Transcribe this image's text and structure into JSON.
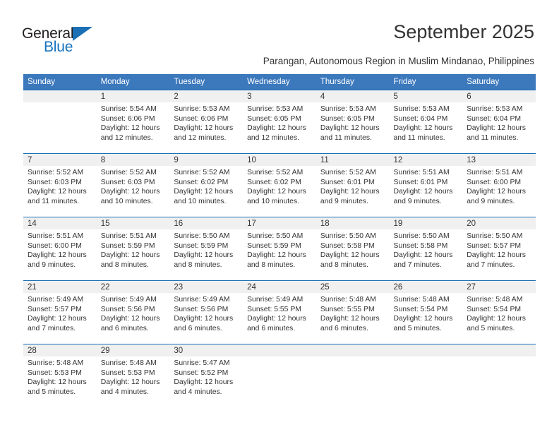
{
  "brand": {
    "name_top": "General",
    "name_bottom": "Blue"
  },
  "header": {
    "title": "September 2025",
    "subtitle": "Parangan, Autonomous Region in Muslim Mindanao, Philippines"
  },
  "colors": {
    "header_blue": "#3b78bc",
    "rule_blue": "#1a6fb5",
    "daynum_band": "#f0f0f0",
    "logo_blue": "#1673c0",
    "text": "#333333"
  },
  "calendar": {
    "weekday_headers": [
      "Sunday",
      "Monday",
      "Tuesday",
      "Wednesday",
      "Thursday",
      "Friday",
      "Saturday"
    ],
    "weeks": [
      [
        {
          "day": "",
          "sunrise": "",
          "sunset": "",
          "daylight": ""
        },
        {
          "day": "1",
          "sunrise": "Sunrise: 5:54 AM",
          "sunset": "Sunset: 6:06 PM",
          "daylight": "Daylight: 12 hours and 12 minutes."
        },
        {
          "day": "2",
          "sunrise": "Sunrise: 5:53 AM",
          "sunset": "Sunset: 6:06 PM",
          "daylight": "Daylight: 12 hours and 12 minutes."
        },
        {
          "day": "3",
          "sunrise": "Sunrise: 5:53 AM",
          "sunset": "Sunset: 6:05 PM",
          "daylight": "Daylight: 12 hours and 12 minutes."
        },
        {
          "day": "4",
          "sunrise": "Sunrise: 5:53 AM",
          "sunset": "Sunset: 6:05 PM",
          "daylight": "Daylight: 12 hours and 11 minutes."
        },
        {
          "day": "5",
          "sunrise": "Sunrise: 5:53 AM",
          "sunset": "Sunset: 6:04 PM",
          "daylight": "Daylight: 12 hours and 11 minutes."
        },
        {
          "day": "6",
          "sunrise": "Sunrise: 5:53 AM",
          "sunset": "Sunset: 6:04 PM",
          "daylight": "Daylight: 12 hours and 11 minutes."
        }
      ],
      [
        {
          "day": "7",
          "sunrise": "Sunrise: 5:52 AM",
          "sunset": "Sunset: 6:03 PM",
          "daylight": "Daylight: 12 hours and 11 minutes."
        },
        {
          "day": "8",
          "sunrise": "Sunrise: 5:52 AM",
          "sunset": "Sunset: 6:03 PM",
          "daylight": "Daylight: 12 hours and 10 minutes."
        },
        {
          "day": "9",
          "sunrise": "Sunrise: 5:52 AM",
          "sunset": "Sunset: 6:02 PM",
          "daylight": "Daylight: 12 hours and 10 minutes."
        },
        {
          "day": "10",
          "sunrise": "Sunrise: 5:52 AM",
          "sunset": "Sunset: 6:02 PM",
          "daylight": "Daylight: 12 hours and 10 minutes."
        },
        {
          "day": "11",
          "sunrise": "Sunrise: 5:52 AM",
          "sunset": "Sunset: 6:01 PM",
          "daylight": "Daylight: 12 hours and 9 minutes."
        },
        {
          "day": "12",
          "sunrise": "Sunrise: 5:51 AM",
          "sunset": "Sunset: 6:01 PM",
          "daylight": "Daylight: 12 hours and 9 minutes."
        },
        {
          "day": "13",
          "sunrise": "Sunrise: 5:51 AM",
          "sunset": "Sunset: 6:00 PM",
          "daylight": "Daylight: 12 hours and 9 minutes."
        }
      ],
      [
        {
          "day": "14",
          "sunrise": "Sunrise: 5:51 AM",
          "sunset": "Sunset: 6:00 PM",
          "daylight": "Daylight: 12 hours and 9 minutes."
        },
        {
          "day": "15",
          "sunrise": "Sunrise: 5:51 AM",
          "sunset": "Sunset: 5:59 PM",
          "daylight": "Daylight: 12 hours and 8 minutes."
        },
        {
          "day": "16",
          "sunrise": "Sunrise: 5:50 AM",
          "sunset": "Sunset: 5:59 PM",
          "daylight": "Daylight: 12 hours and 8 minutes."
        },
        {
          "day": "17",
          "sunrise": "Sunrise: 5:50 AM",
          "sunset": "Sunset: 5:59 PM",
          "daylight": "Daylight: 12 hours and 8 minutes."
        },
        {
          "day": "18",
          "sunrise": "Sunrise: 5:50 AM",
          "sunset": "Sunset: 5:58 PM",
          "daylight": "Daylight: 12 hours and 8 minutes."
        },
        {
          "day": "19",
          "sunrise": "Sunrise: 5:50 AM",
          "sunset": "Sunset: 5:58 PM",
          "daylight": "Daylight: 12 hours and 7 minutes."
        },
        {
          "day": "20",
          "sunrise": "Sunrise: 5:50 AM",
          "sunset": "Sunset: 5:57 PM",
          "daylight": "Daylight: 12 hours and 7 minutes."
        }
      ],
      [
        {
          "day": "21",
          "sunrise": "Sunrise: 5:49 AM",
          "sunset": "Sunset: 5:57 PM",
          "daylight": "Daylight: 12 hours and 7 minutes."
        },
        {
          "day": "22",
          "sunrise": "Sunrise: 5:49 AM",
          "sunset": "Sunset: 5:56 PM",
          "daylight": "Daylight: 12 hours and 6 minutes."
        },
        {
          "day": "23",
          "sunrise": "Sunrise: 5:49 AM",
          "sunset": "Sunset: 5:56 PM",
          "daylight": "Daylight: 12 hours and 6 minutes."
        },
        {
          "day": "24",
          "sunrise": "Sunrise: 5:49 AM",
          "sunset": "Sunset: 5:55 PM",
          "daylight": "Daylight: 12 hours and 6 minutes."
        },
        {
          "day": "25",
          "sunrise": "Sunrise: 5:48 AM",
          "sunset": "Sunset: 5:55 PM",
          "daylight": "Daylight: 12 hours and 6 minutes."
        },
        {
          "day": "26",
          "sunrise": "Sunrise: 5:48 AM",
          "sunset": "Sunset: 5:54 PM",
          "daylight": "Daylight: 12 hours and 5 minutes."
        },
        {
          "day": "27",
          "sunrise": "Sunrise: 5:48 AM",
          "sunset": "Sunset: 5:54 PM",
          "daylight": "Daylight: 12 hours and 5 minutes."
        }
      ],
      [
        {
          "day": "28",
          "sunrise": "Sunrise: 5:48 AM",
          "sunset": "Sunset: 5:53 PM",
          "daylight": "Daylight: 12 hours and 5 minutes."
        },
        {
          "day": "29",
          "sunrise": "Sunrise: 5:48 AM",
          "sunset": "Sunset: 5:53 PM",
          "daylight": "Daylight: 12 hours and 4 minutes."
        },
        {
          "day": "30",
          "sunrise": "Sunrise: 5:47 AM",
          "sunset": "Sunset: 5:52 PM",
          "daylight": "Daylight: 12 hours and 4 minutes."
        },
        {
          "day": "",
          "sunrise": "",
          "sunset": "",
          "daylight": ""
        },
        {
          "day": "",
          "sunrise": "",
          "sunset": "",
          "daylight": ""
        },
        {
          "day": "",
          "sunrise": "",
          "sunset": "",
          "daylight": ""
        },
        {
          "day": "",
          "sunrise": "",
          "sunset": "",
          "daylight": ""
        }
      ]
    ]
  }
}
